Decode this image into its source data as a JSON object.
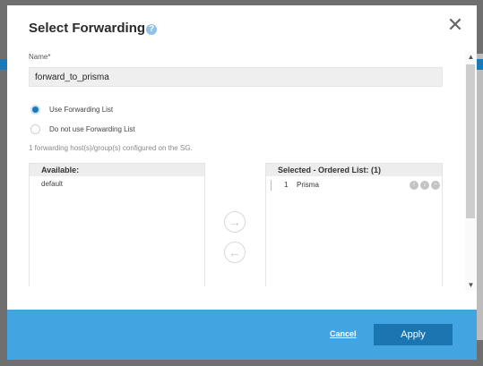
{
  "dialog": {
    "title": "Select Forwarding",
    "help_icon_glyph": "?",
    "close_icon": "close-icon"
  },
  "name_field": {
    "label": "Name*",
    "value": "forward_to_prisma"
  },
  "options": [
    {
      "label": "Use Forwarding List",
      "selected": true
    },
    {
      "label": "Do not use Forwarding List",
      "selected": false
    }
  ],
  "configured_text": "1 forwarding host(s)/group(s) configured on the SG.",
  "available": {
    "header": "Available:",
    "items": [
      "default"
    ]
  },
  "selected": {
    "header": "Selected - Ordered List: (1)",
    "items": [
      {
        "index": "1",
        "name": "Prisma"
      }
    ]
  },
  "footer": {
    "cancel_label": "Cancel",
    "apply_label": "Apply"
  },
  "colors": {
    "accent": "#1a75b0",
    "footer": "#42a5e2"
  }
}
